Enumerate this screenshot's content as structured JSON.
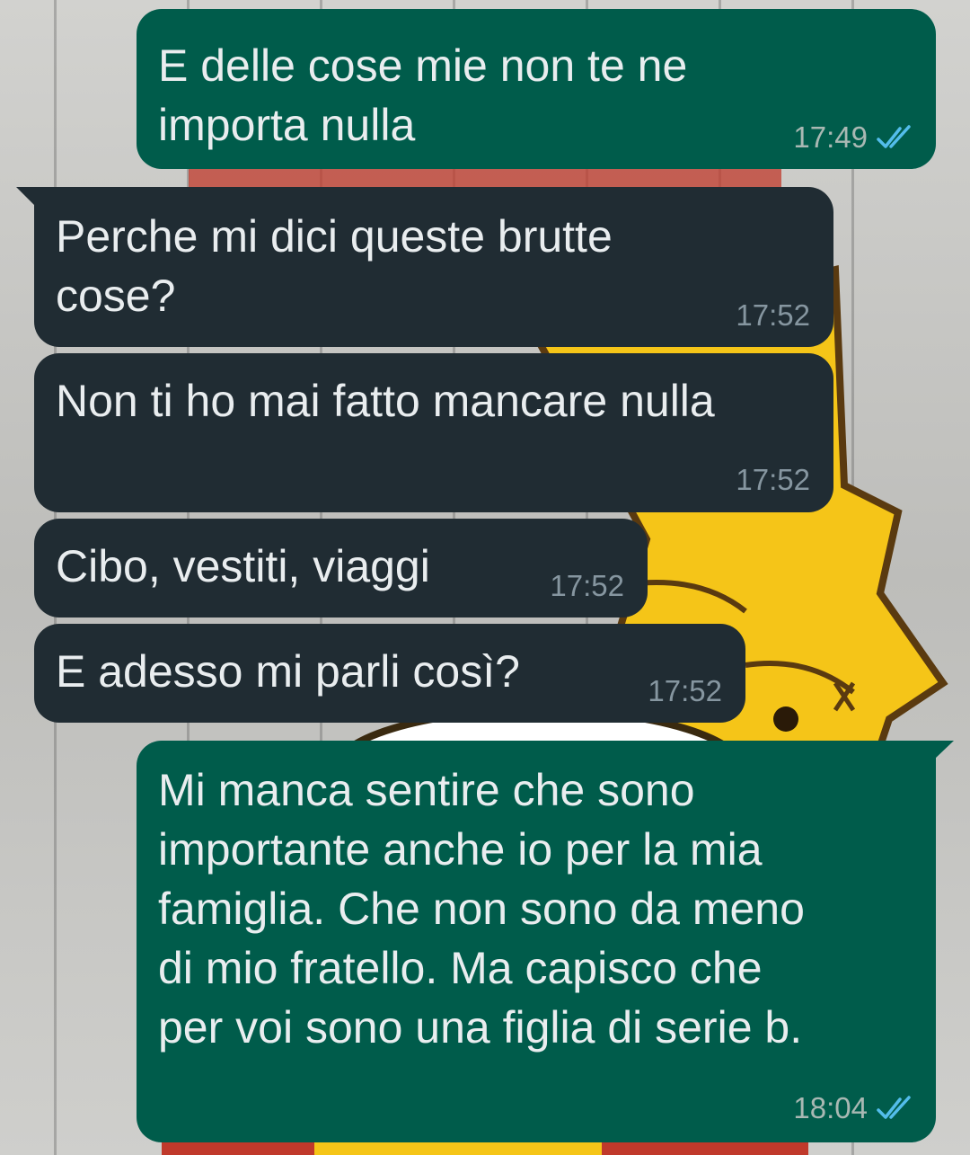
{
  "colors": {
    "outgoing_bubble": "#005c4b",
    "incoming_bubble": "#202c33",
    "message_text": "#e9edef",
    "read_ticks": "#53bdeb",
    "wallpaper_wood": "#c9c9c6",
    "wallpaper_character_yellow": "#f5c518"
  },
  "icons": {
    "read_receipt": "double-check-icon"
  },
  "messages": [
    {
      "direction": "outgoing",
      "text": "E delle cose mie non te ne\nimporta nulla",
      "time": "17:49",
      "status": "read"
    },
    {
      "direction": "incoming",
      "text": "Perche mi dici queste brutte\ncose?",
      "time": "17:52"
    },
    {
      "direction": "incoming",
      "text": "Non ti ho mai fatto mancare nulla",
      "time": "17:52"
    },
    {
      "direction": "incoming",
      "text": "Cibo, vestiti, viaggi",
      "time": "17:52"
    },
    {
      "direction": "incoming",
      "text": "E adesso mi parli così?",
      "time": "17:52"
    },
    {
      "direction": "outgoing",
      "text": "Mi manca sentire che sono\nimportante anche io per la mia\nfamiglia. Che non sono da meno\ndi mio fratello. Ma capisco che\nper voi sono una figlia di serie b.",
      "time": "18:04",
      "status": "read"
    }
  ]
}
